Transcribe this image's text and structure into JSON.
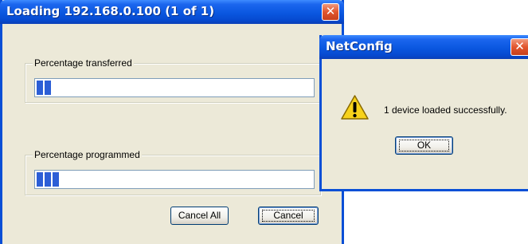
{
  "loading_window": {
    "title": "Loading 192.168.0.100 (1 of 1)",
    "transferred": {
      "label": "Percentage transferred",
      "progress_blocks": 2
    },
    "programmed": {
      "label": "Percentage programmed",
      "progress_blocks": 3
    },
    "buttons": {
      "cancel_all": "Cancel All",
      "cancel": "Cancel"
    }
  },
  "message_box": {
    "title": "NetConfig",
    "icon": "warning-icon",
    "message": "1 device loaded successfully.",
    "ok_label": "OK"
  },
  "colors": {
    "titlebar": "#0a57e0",
    "progress": "#2c5ed6",
    "window_bg": "#ece9d8",
    "close": "#e2552d"
  }
}
